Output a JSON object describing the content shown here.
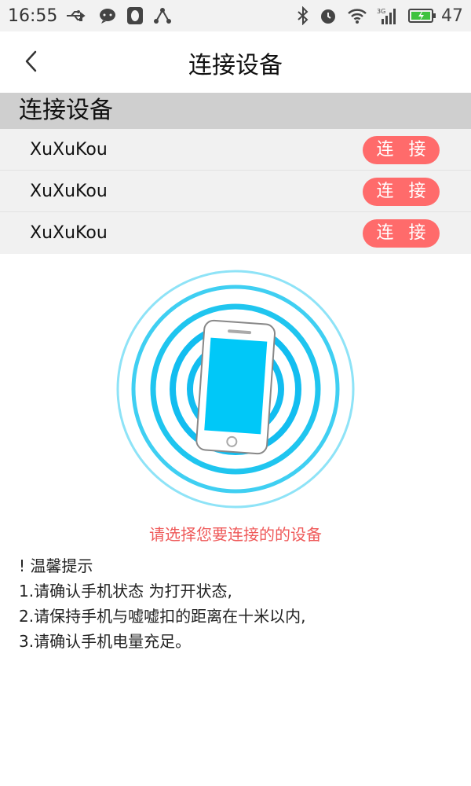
{
  "status_bar": {
    "time": "16:55",
    "battery_level": "47"
  },
  "header": {
    "title": "连接设备"
  },
  "section": {
    "title": "连接设备"
  },
  "devices": [
    {
      "name": "XuXuKou",
      "button_label": "连 接"
    },
    {
      "name": "XuXuKou",
      "button_label": "连 接"
    },
    {
      "name": "XuXuKou",
      "button_label": "连 接"
    }
  ],
  "prompt": "请选择您要连接的的设备",
  "tips": {
    "title": "! 温馨提示",
    "items": [
      "1.请确认手机状态 为打开状态,",
      "2.请保持手机与嘘嘘扣的距离在十米以内,",
      "3.请确认手机电量充足。"
    ]
  },
  "colors": {
    "accent": "#ff6b6b",
    "ring": "#29c6f0",
    "screen": "#00c8f8"
  }
}
